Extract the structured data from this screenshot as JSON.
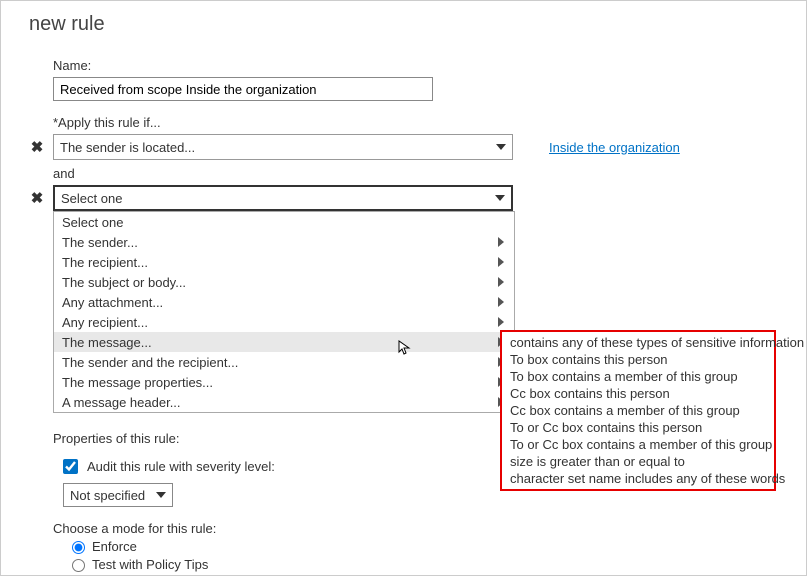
{
  "title": "new rule",
  "name_label": "Name:",
  "name_value": "Received from scope Inside the organization",
  "apply_label": "*Apply this rule if...",
  "condition1_text": "The sender is located...",
  "condition1_link": "Inside the organization",
  "and_label": "and",
  "condition2_text": "Select one",
  "menu": {
    "items": [
      {
        "label": "Select one",
        "arrow": false
      },
      {
        "label": "The sender...",
        "arrow": true
      },
      {
        "label": "The recipient...",
        "arrow": true
      },
      {
        "label": "The subject or body...",
        "arrow": true
      },
      {
        "label": "Any attachment...",
        "arrow": true
      },
      {
        "label": "Any recipient...",
        "arrow": true
      },
      {
        "label": "The message...",
        "arrow": true,
        "hovered": true
      },
      {
        "label": "The sender and the recipient...",
        "arrow": true
      },
      {
        "label": "The message properties...",
        "arrow": true
      },
      {
        "label": "A message header...",
        "arrow": true
      }
    ]
  },
  "submenu": {
    "items": [
      "contains any of these types of sensitive information",
      "To box contains this person",
      "To box contains a member of this group",
      "Cc box contains this person",
      "Cc box contains a member of this group",
      "To or Cc box contains this person",
      "To or Cc box contains a member of this group",
      "size is greater than or equal to",
      "character set name includes any of these words"
    ]
  },
  "properties_label": "Properties of this rule:",
  "audit_label": "Audit this rule with severity level:",
  "severity_value": "Not specified",
  "mode_label": "Choose a mode for this rule:",
  "mode_enforce": "Enforce",
  "mode_testtips": "Test with Policy Tips",
  "x_glyph": "✖"
}
